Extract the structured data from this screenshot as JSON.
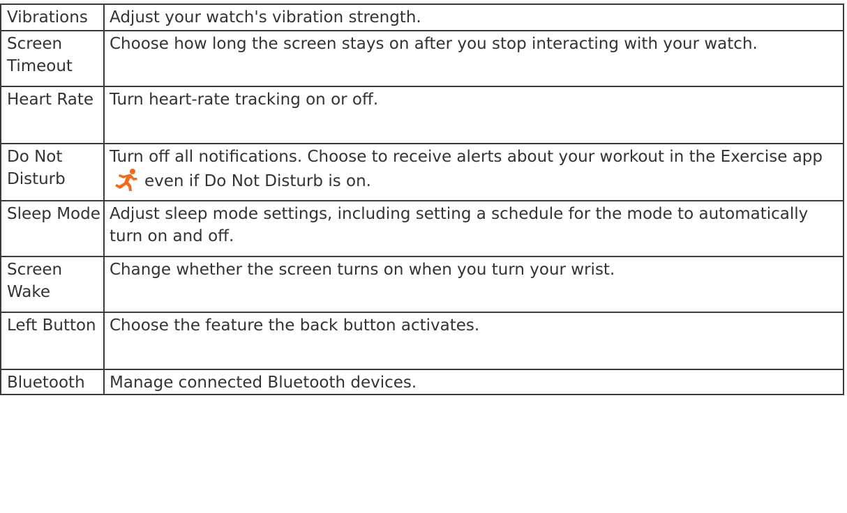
{
  "settings": [
    {
      "name": "Vibrations",
      "description": "Adjust your watch's vibration strength."
    },
    {
      "name": "Screen Timeout",
      "description": "Choose how long the screen stays on after you stop interacting with your watch."
    },
    {
      "name": "Heart Rate",
      "description": "Turn heart-rate tracking on or off."
    },
    {
      "name": "Do Not Disturb",
      "description_before": "Turn off all notifications. Choose to receive alerts about your workout in the Exercise app",
      "icon": "exercise-runner-icon",
      "description_after": "even if Do Not Disturb is on."
    },
    {
      "name": "Sleep Mode",
      "description": "Adjust sleep mode settings, including setting a schedule for the mode to automatically turn on and off."
    },
    {
      "name": "Screen Wake",
      "description": "Change whether the screen turns on when you turn your wrist."
    },
    {
      "name": "Left Button",
      "description_before": "Choose the feature the",
      "button_word": "back",
      "description_after": "button activates."
    },
    {
      "name": "Bluetooth",
      "description": "Manage connected Bluetooth devices."
    }
  ],
  "colors": {
    "text": "#333333",
    "border": "#3a3a3a",
    "icon_orange": "#f26a1b"
  }
}
